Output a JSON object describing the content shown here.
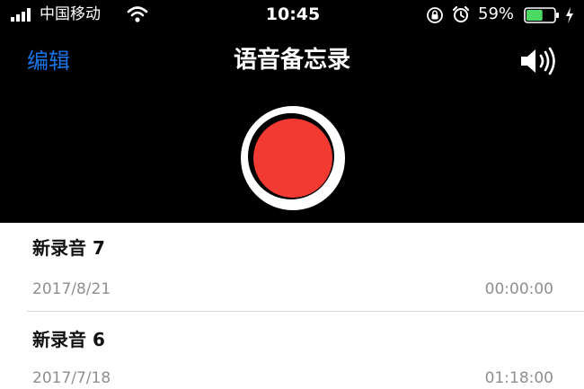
{
  "status_bar": {
    "carrier": "中国移动",
    "time": "10:45",
    "battery": "59%",
    "battery_level": 0.59,
    "icons": [
      "signal-icon",
      "wifi-icon",
      "orientation-lock-icon",
      "alarm-icon",
      "battery-icon",
      "charging-bolt-icon"
    ]
  },
  "nav": {
    "edit_label": "编辑",
    "title": "语音备忘录",
    "speaker_icon": "speaker-icon"
  },
  "record": {
    "icon": "record-icon",
    "accent_color": "#f23a32"
  },
  "colors": {
    "tint": "#1a74e8",
    "header_bg": "#000000",
    "secondary_text": "#8e8e93"
  },
  "recordings": [
    {
      "title": "新录音 7",
      "date": "2017/8/21",
      "duration": "00:00:00"
    },
    {
      "title": "新录音 6",
      "date": "2017/7/18",
      "duration": "01:18:00"
    }
  ]
}
